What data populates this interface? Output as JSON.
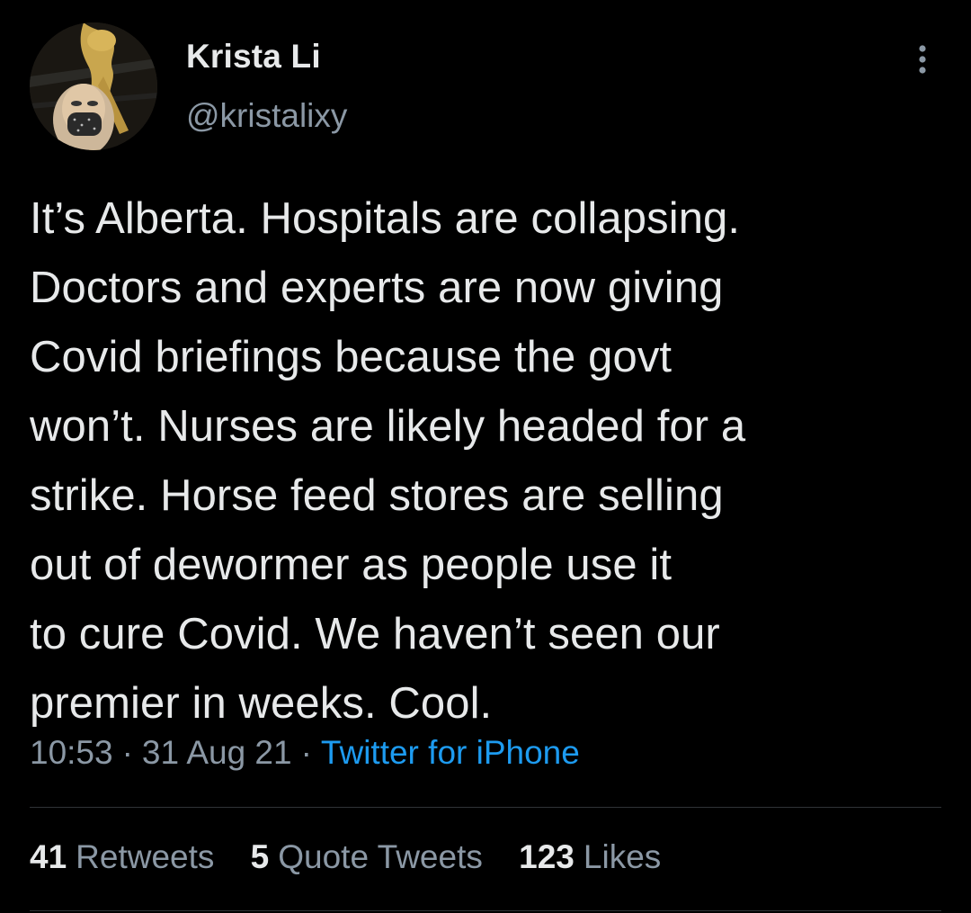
{
  "author": {
    "display_name": "Krista Li",
    "handle": "@kristalixy"
  },
  "tweet": {
    "lines": [
      "It’s Alberta. Hospitals are collapsing.",
      "Doctors and experts are now giving",
      "Covid briefings because the govt",
      "won’t. Nurses are likely headed for a",
      "strike. Horse feed stores are selling",
      "out of dewormer as people use it",
      "to cure Covid. We haven’t seen our",
      "premier in weeks. Cool."
    ],
    "time": "10:53",
    "date": "31 Aug 21",
    "separator": "·",
    "source": "Twitter for iPhone"
  },
  "stats": {
    "retweets": {
      "count": "41",
      "label": "Retweets"
    },
    "quote_tweets": {
      "count": "5",
      "label": "Quote Tweets"
    },
    "likes": {
      "count": "123",
      "label": "Likes"
    }
  },
  "icons": {
    "more": "more-vertical-icon",
    "avatar": "profile-photo"
  },
  "colors": {
    "background": "#000000",
    "text": "#e7e9ea",
    "secondary": "#8b98a5",
    "link": "#1d9bf0",
    "divider": "#2f3336"
  }
}
